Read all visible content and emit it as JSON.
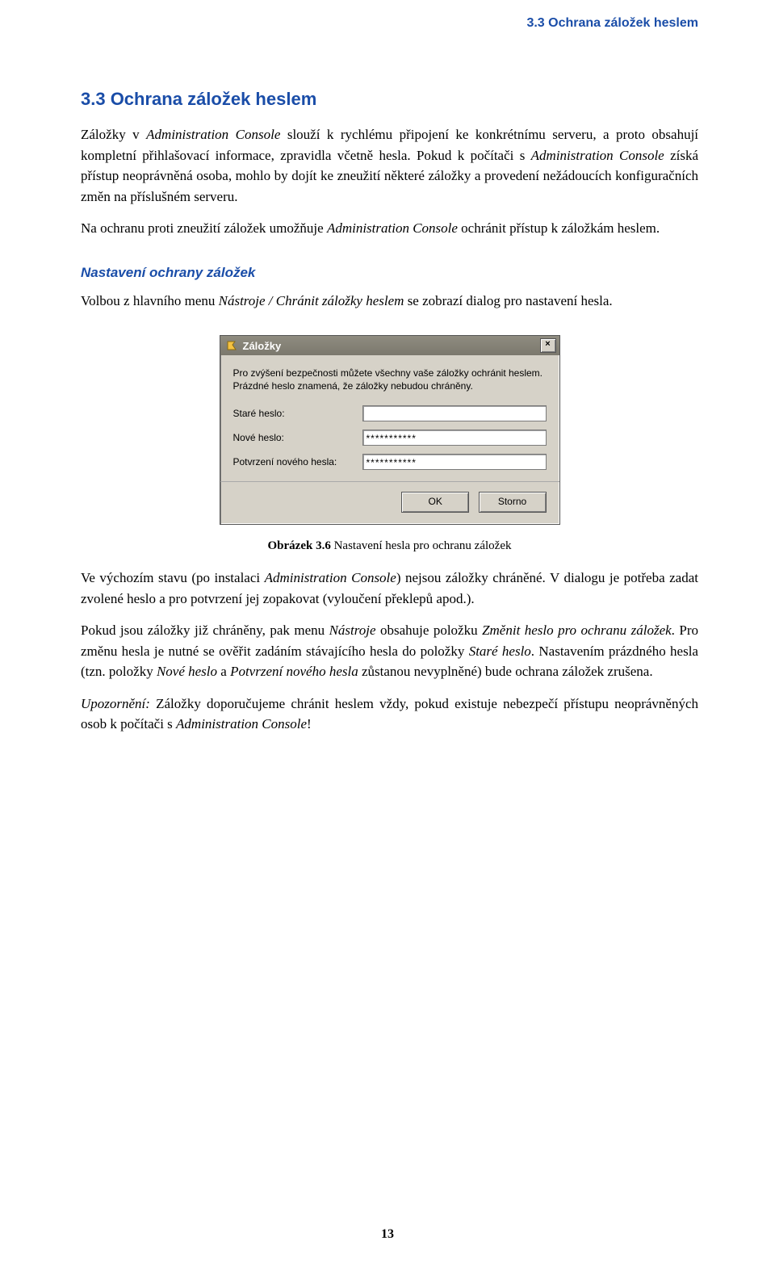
{
  "running_header": "3.3 Ochrana záložek heslem",
  "section_heading": "3.3 Ochrana záložek heslem",
  "para1_a": "Záložky v ",
  "para1_b": "Administration Console",
  "para1_c": " slouží k rychlému připojení ke konkrétnímu serveru, a proto obsahují kompletní přihlašovací informace, zpravidla včetně hesla. Pokud k počítači s ",
  "para1_d": "Administration Console",
  "para1_e": " získá přístup neoprávněná osoba, mohlo by dojít ke zneužití některé záložky a provedení nežádoucích konfiguračních změn na příslušném serveru.",
  "para2_a": "Na ochranu proti zneužití záložek umožňuje ",
  "para2_b": "Administration Console",
  "para2_c": " ochránit přístup k záložkám heslem.",
  "subheading": "Nastavení ochrany záložek",
  "para3_a": "Volbou z hlavního menu ",
  "para3_b": "Nástroje / Chránit záložky heslem",
  "para3_c": " se zobrazí dialog pro nastavení hesla.",
  "dialog": {
    "title": "Záložky",
    "close": "×",
    "message": "Pro zvýšení bezpečnosti můžete všechny vaše záložky ochránit heslem. Prázdné heslo znamená, že záložky nebudou chráněny.",
    "label_old": "Staré heslo:",
    "label_new": "Nové heslo:",
    "label_confirm": "Potvrzení nového hesla:",
    "value_old": "",
    "value_new": "***********",
    "value_confirm": "***********",
    "ok": "OK",
    "cancel": "Storno"
  },
  "caption_bold": "Obrázek 3.6",
  "caption_rest": "   Nastavení hesla pro ochranu záložek",
  "para4_a": "Ve výchozím stavu (po instalaci ",
  "para4_b": "Administration Console",
  "para4_c": ") nejsou záložky chráněné. V dialogu je potřeba zadat zvolené heslo a pro potvrzení jej zopakovat (vyloučení překlepů apod.).",
  "para5_a": "Pokud jsou záložky již chráněny, pak menu ",
  "para5_b": "Nástroje",
  "para5_c": " obsahuje položku ",
  "para5_d": "Změnit heslo pro ochranu záložek",
  "para5_e": ". Pro změnu hesla je nutné se ověřit zadáním stávajícího hesla do položky ",
  "para5_f": "Staré heslo",
  "para5_g": ". Nastavením prázdného hesla (tzn. položky ",
  "para5_h": "Nové heslo",
  "para5_i": " a ",
  "para5_j": "Potvrzení nového hesla",
  "para5_k": " zůstanou nevyplněné) bude ochrana záložek zrušena.",
  "para6_a": "Upozornění:",
  "para6_b": " Záložky doporučujeme chránit heslem vždy, pokud existuje nebezpečí přístupu neoprávněných osob k počítači s ",
  "para6_c": "Administration Console",
  "para6_d": "!",
  "page_number": "13"
}
